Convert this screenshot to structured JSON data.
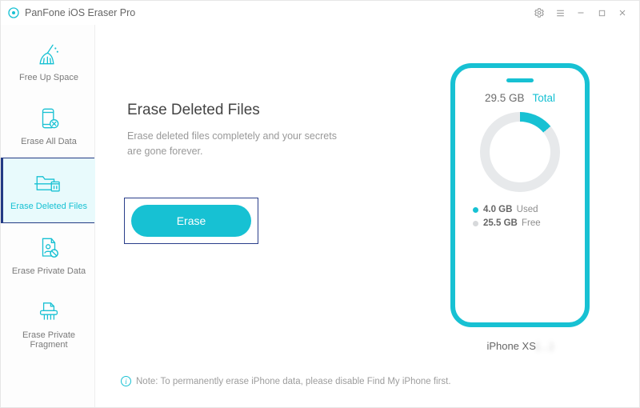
{
  "app": {
    "title": "PanFone iOS Eraser Pro"
  },
  "sidebar": {
    "items": [
      {
        "label": "Free Up Space"
      },
      {
        "label": "Erase All Data"
      },
      {
        "label": "Erase Deleted Files"
      },
      {
        "label": "Erase Private Data"
      },
      {
        "label": "Erase Private Fragment"
      }
    ],
    "active_index": 2
  },
  "main": {
    "heading": "Erase Deleted Files",
    "description": "Erase deleted files completely and your secrets are gone forever.",
    "erase_button": "Erase",
    "note": "Note: To permanently erase iPhone data, please disable Find My iPhone first."
  },
  "device": {
    "total_label": "Total",
    "total_storage": "29.5 GB",
    "used_value": "4.0 GB",
    "used_label": "Used",
    "free_value": "25.5 GB",
    "free_label": "Free",
    "name": "iPhone XS",
    "name_suffix_obscured": "(…)"
  }
}
